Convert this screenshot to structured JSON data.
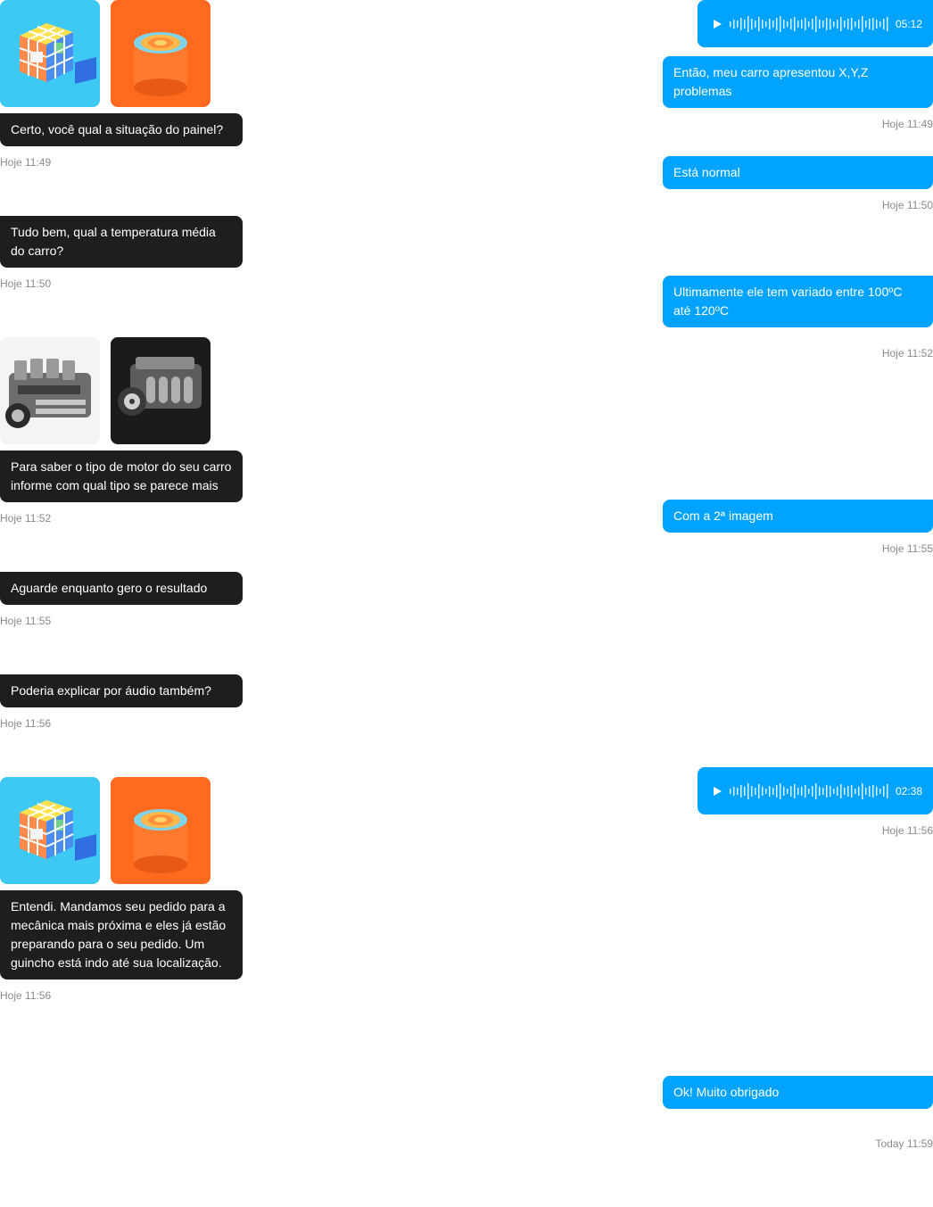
{
  "colors": {
    "incoming_bubble": "#1e1e1e",
    "outgoing_bubble": "#00a3ff",
    "timestamp": "#8a8a8a"
  },
  "messages": [
    {
      "type": "images",
      "side": "in",
      "images": [
        "rubiks-cube-3d-icon",
        "orange-cylinder-3d-icon"
      ]
    },
    {
      "side": "in",
      "text": "Certo, você qual a situação do painel?",
      "time": "Hoje 11:49"
    },
    {
      "side": "in",
      "text": "Tudo bem, qual a temperatura média do carro?",
      "time": "Hoje 11:50"
    },
    {
      "type": "images",
      "side": "in",
      "images": [
        "v8-engine-photo",
        "v12-engine-photo"
      ]
    },
    {
      "side": "in",
      "text": "Para saber o tipo de motor do seu carro informe com qual tipo se parece mais",
      "time": "Hoje 11:52"
    },
    {
      "side": "in",
      "text": "Aguarde enquanto gero o resultado",
      "time": "Hoje 11:55"
    },
    {
      "side": "in",
      "text": "Poderia explicar por áudio também?",
      "time": "Hoje 11:56"
    },
    {
      "type": "images",
      "side": "in",
      "images": [
        "rubiks-cube-3d-icon",
        "orange-cylinder-3d-icon"
      ]
    },
    {
      "side": "in",
      "text": "Entendi. Mandamos seu pedido para a mecânica mais próxima e eles já estão preparando para o seu pedido. Um guincho está indo até sua localização.",
      "time": "Hoje 11:56"
    },
    {
      "type": "audio",
      "side": "out",
      "duration": "05:12"
    },
    {
      "side": "out",
      "text": "Então, meu carro apresentou X,Y,Z problemas",
      "time": "Hoje 11:49"
    },
    {
      "side": "out",
      "text": "Está normal",
      "time": "Hoje 11:50"
    },
    {
      "side": "out",
      "text": "Ultimamente ele tem variado entre 100ºC até 120ºC",
      "time": "Hoje 11:52"
    },
    {
      "side": "out",
      "text": "Com a 2ª imagem",
      "time": "Hoje 11:55"
    },
    {
      "type": "audio",
      "side": "out",
      "duration": "02:38",
      "time": "Hoje 11:56"
    },
    {
      "side": "out",
      "text": "Ok! Muito obrigado",
      "time": "Today 11:59"
    }
  ]
}
